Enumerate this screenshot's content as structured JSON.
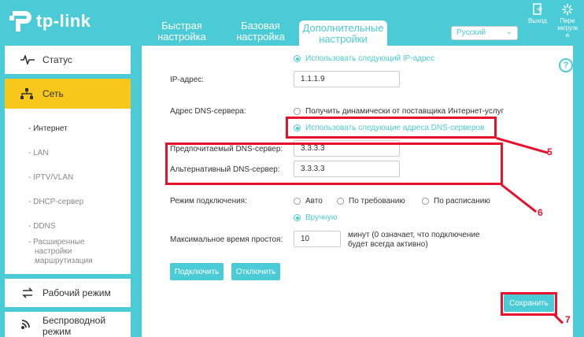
{
  "header": {
    "logo_text": "tp-link",
    "tabs": [
      {
        "line1": "Быстрая",
        "line2": "настройка"
      },
      {
        "line1": "Базовая",
        "line2": "настройка"
      },
      {
        "line1": "Дополнительные",
        "line2": "настройки"
      }
    ],
    "language": "Русский",
    "logout_label": "Выход",
    "reboot_label_1": "Пере",
    "reboot_label_2": "загрузк",
    "reboot_label_3": "а"
  },
  "sidebar": {
    "items": [
      {
        "label": "Статус"
      },
      {
        "label": "Сеть"
      },
      {
        "label": "Рабочий режим"
      },
      {
        "label": "Беспроводной",
        "label2": "режим"
      }
    ],
    "sub_items": [
      {
        "label": "- Интернет"
      },
      {
        "label": "- LAN"
      },
      {
        "label": "- IPTV/VLAN"
      },
      {
        "label": "- DHCP-сервер"
      },
      {
        "label": "- DDNS"
      },
      {
        "label": "- Расширенные",
        "label2": "настройки",
        "label3": "маршрутизации"
      }
    ]
  },
  "form": {
    "use_ip_option": "Использовать следующий IP-адрес",
    "ip_label": "IP-адрес:",
    "ip_value": "1.1.1.9",
    "dns_label": "Адрес DNS-сервера:",
    "dns_auto_option": "Получить динамически от поставщика Интернет-услуг",
    "dns_manual_option": "Использовать следующие адреса DNS-серверов",
    "preferred_dns_label": "Предпочитаемый DNS-сервер:",
    "preferred_dns_value": "3.3.3.3",
    "alt_dns_label": "Альтернативный DNS-сервер:",
    "alt_dns_value": "3.3.3.3",
    "mode_label": "Режим подключения:",
    "mode_auto": "Авто",
    "mode_demand": "По требованию",
    "mode_schedule": "По расписанию",
    "mode_manual": "Вручную",
    "idle_label": "Максимальное время простоя:",
    "idle_value": "10",
    "idle_note_1": "минут (0 означает, что подключение",
    "idle_note_2": "будет всегда активно)",
    "connect_button": "Подключить",
    "disconnect_button": "Отключить",
    "save_button": "Сохранить"
  },
  "annotations": {
    "callout_5": "5",
    "callout_6": "6",
    "callout_7": "7"
  },
  "colors": {
    "accent": "#4acbd6",
    "active_nav": "#f8c71c",
    "annotation": "#e8112d"
  }
}
